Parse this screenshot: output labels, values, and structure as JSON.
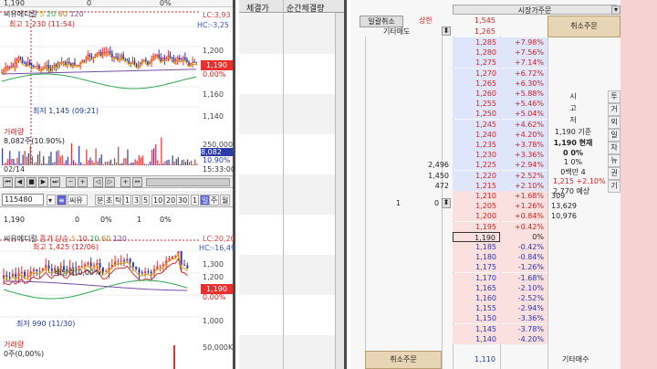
{
  "chart1": {
    "name": "씨유메디칼",
    "legend": [
      "5",
      "20",
      "60",
      "120"
    ],
    "legend_colors": [
      "#e89c00",
      "#2fa84f",
      "#b07a2a",
      "#7a4ca8"
    ],
    "lc": "LC:3,93",
    "hc": "HC:-3,25",
    "high_label": "최고 1,230 (11:54)",
    "low_label": "최저 1,145 (09:21)",
    "ticks": [
      "1,200",
      "1,160",
      "1,140"
    ],
    "current_price": "1,190",
    "current_pct": "0.00%",
    "volume_title": "거래량",
    "volume_value": "8,082주(10.90%)",
    "volume_tick": "250,000",
    "volume_tag": "8,082",
    "volume_pct": "10.90%",
    "date": "02/14",
    "time": "15:33:00"
  },
  "top_strip": {
    "price": "1,190",
    "zero": "0",
    "pct": "0%"
  },
  "code_row": {
    "code": "115480",
    "name": "씨유",
    "items": [
      "분",
      "초",
      "틱",
      "1",
      "3",
      "5",
      "10",
      "20",
      "30",
      "1",
      "일",
      "주",
      "월"
    ]
  },
  "info_row2": {
    "price": "1,190",
    "zero": "0",
    "pct": "0%",
    "one": "1",
    "pct2": "0%"
  },
  "chart2": {
    "name": "씨유메디칼",
    "legend_label": "종가 단순",
    "legend": [
      "5",
      "10",
      "20",
      "60",
      "120"
    ],
    "legend_colors": [
      "#e89c00",
      "#d03030",
      "#2fa84f",
      "#b07a2a",
      "#7a4ca8"
    ],
    "lc": "LC:20,20",
    "hc": "HC:-16,49",
    "high_label": "최고 1,425 (12/06)",
    "low_label": "최저 990 (11/30)",
    "div_label": "배당락(0,00%)",
    "ticks": [
      "1,300",
      "1,200",
      "1,000"
    ],
    "current_price": "1,190",
    "current_pct": "0.00%",
    "volume_title": "거래량",
    "volume_value": "0주(0,00%)",
    "volume_tick": "50,000K"
  },
  "middle": {
    "col1": "체결가",
    "col2": "순간체결량"
  },
  "book": {
    "market_order": "시장가주문",
    "cancel_all": "일괄취소",
    "upper_limit": "상한",
    "upper_price": "1,545",
    "other_sell": "기타매도",
    "other_sell_price": "1,265",
    "cancel_order": "취소주문",
    "cancel_order2": "취소주문",
    "other_buy": "기타매수",
    "sell_rows": [
      {
        "price": "1,285",
        "pct": "+7.98%"
      },
      {
        "price": "1,280",
        "pct": "+7.56%"
      },
      {
        "price": "1,275",
        "pct": "+7.14%"
      },
      {
        "price": "1,270",
        "pct": "+6.72%"
      },
      {
        "price": "1,265",
        "pct": "+6.30%"
      },
      {
        "price": "1,260",
        "pct": "+5.88%"
      },
      {
        "price": "1,255",
        "pct": "+5.46%"
      },
      {
        "price": "1,250",
        "pct": "+5.04%"
      },
      {
        "price": "1,245",
        "pct": "+4.62%"
      },
      {
        "price": "1,240",
        "pct": "+4.20%"
      },
      {
        "price": "1,235",
        "pct": "+3.78%"
      },
      {
        "price": "1,230",
        "pct": "+3.36%"
      },
      {
        "price": "1,225",
        "pct": "+2.94%",
        "qty": "2,496"
      },
      {
        "price": "1,220",
        "pct": "+2.52%",
        "qty": "1,450"
      },
      {
        "price": "1,215",
        "pct": "+2.10%",
        "qty": "472"
      }
    ],
    "buy_rows": [
      {
        "price": "1,210",
        "pct": "+1.68%",
        "qty": "309"
      },
      {
        "price": "1,205",
        "pct": "+1.26%",
        "qty": "13,629"
      },
      {
        "price": "1,200",
        "pct": "+0.84%",
        "qty": "10,976"
      },
      {
        "price": "1,195",
        "pct": "+0.42%"
      },
      {
        "price": "1,190",
        "pct": "0%"
      },
      {
        "price": "1,185",
        "pct": "-0.42%"
      },
      {
        "price": "1,180",
        "pct": "-0.84%"
      },
      {
        "price": "1,175",
        "pct": "-1.26%"
      },
      {
        "price": "1,170",
        "pct": "-1.68%"
      },
      {
        "price": "1,165",
        "pct": "-2.10%"
      },
      {
        "price": "1,160",
        "pct": "-2.52%"
      },
      {
        "price": "1,155",
        "pct": "-2.94%"
      },
      {
        "price": "1,150",
        "pct": "-3.36%"
      },
      {
        "price": "1,145",
        "pct": "-3.78%"
      },
      {
        "price": "1,140",
        "pct": "-4.20%"
      }
    ],
    "bottom_price": "1,110",
    "row_one": "1",
    "row_zero": "0",
    "info": {
      "v_chars": [
        "시",
        "고",
        "저"
      ],
      "base_label": "1,190 기준",
      "current_label": "1,190 현재",
      "zero_pct": "0 0%",
      "one_pct": "1 0%",
      "amount": "0백만 4",
      "expected": "1,215 +2.10%",
      "expected_qty": "2,770 예상"
    },
    "side_chars": [
      "투",
      "거",
      "외",
      "일",
      "차",
      "뉴",
      "권",
      "기"
    ]
  }
}
